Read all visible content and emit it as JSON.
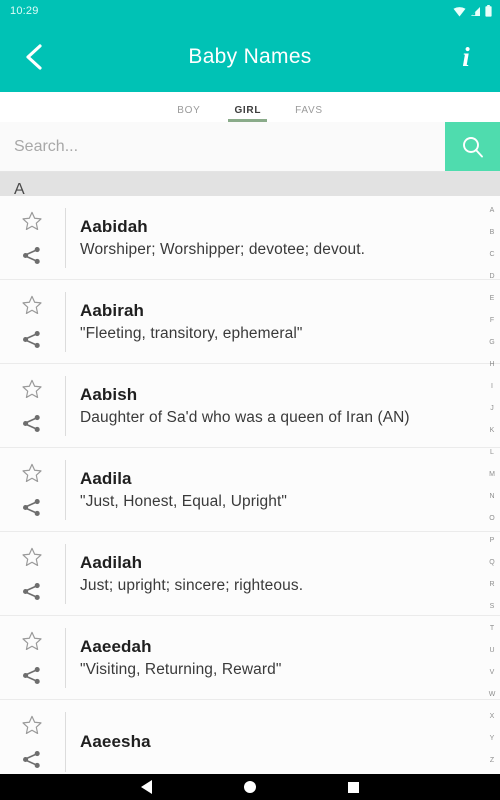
{
  "statusbar": {
    "time": "10:29",
    "icons": [
      "wifi-icon",
      "signal-icon",
      "battery-icon"
    ]
  },
  "appbar": {
    "back_icon": "chevron-left-icon",
    "title": "Baby Names",
    "info_icon": "info-icon",
    "info_label": "i",
    "background_color": "#00C2B5"
  },
  "tabs": [
    {
      "label": "BOY",
      "selected": false
    },
    {
      "label": "GIRL",
      "selected": true
    },
    {
      "label": "FAVS",
      "selected": false
    }
  ],
  "tab_indicator_color": "#8aab8a",
  "search": {
    "placeholder": "Search...",
    "value": "",
    "button_icon": "search-icon",
    "button_color": "#4FDCAE"
  },
  "section": {
    "letter": "A"
  },
  "list": [
    {
      "name": "Aabidah",
      "meaning": "Worshiper; Worshipper; devotee; devout.",
      "star_icon": "star-outline-icon",
      "share_icon": "share-icon"
    },
    {
      "name": "Aabirah",
      "meaning": "\"Fleeting, transitory, ephemeral\"",
      "star_icon": "star-outline-icon",
      "share_icon": "share-icon"
    },
    {
      "name": "Aabish",
      "meaning": "Daughter of Sa'd who was a queen of Iran (AN)",
      "star_icon": "star-outline-icon",
      "share_icon": "share-icon"
    },
    {
      "name": "Aadila",
      "meaning": "\"Just, Honest, Equal, Upright\"",
      "star_icon": "star-outline-icon",
      "share_icon": "share-icon"
    },
    {
      "name": "Aadilah",
      "meaning": "Just; upright; sincere; righteous.",
      "star_icon": "star-outline-icon",
      "share_icon": "share-icon"
    },
    {
      "name": "Aaeedah",
      "meaning": "\"Visiting, Returning, Reward\"",
      "star_icon": "star-outline-icon",
      "share_icon": "share-icon"
    },
    {
      "name": "Aaeesha",
      "meaning": "",
      "star_icon": "star-outline-icon",
      "share_icon": "share-icon"
    }
  ],
  "alpha_index": [
    "A",
    "B",
    "C",
    "D",
    "E",
    "F",
    "G",
    "H",
    "I",
    "J",
    "K",
    "L",
    "M",
    "N",
    "O",
    "P",
    "Q",
    "R",
    "S",
    "T",
    "U",
    "V",
    "W",
    "X",
    "Y",
    "Z"
  ],
  "navbar": {
    "back_icon": "nav-back-icon",
    "home_icon": "nav-home-icon",
    "recents_icon": "nav-recents-icon"
  }
}
